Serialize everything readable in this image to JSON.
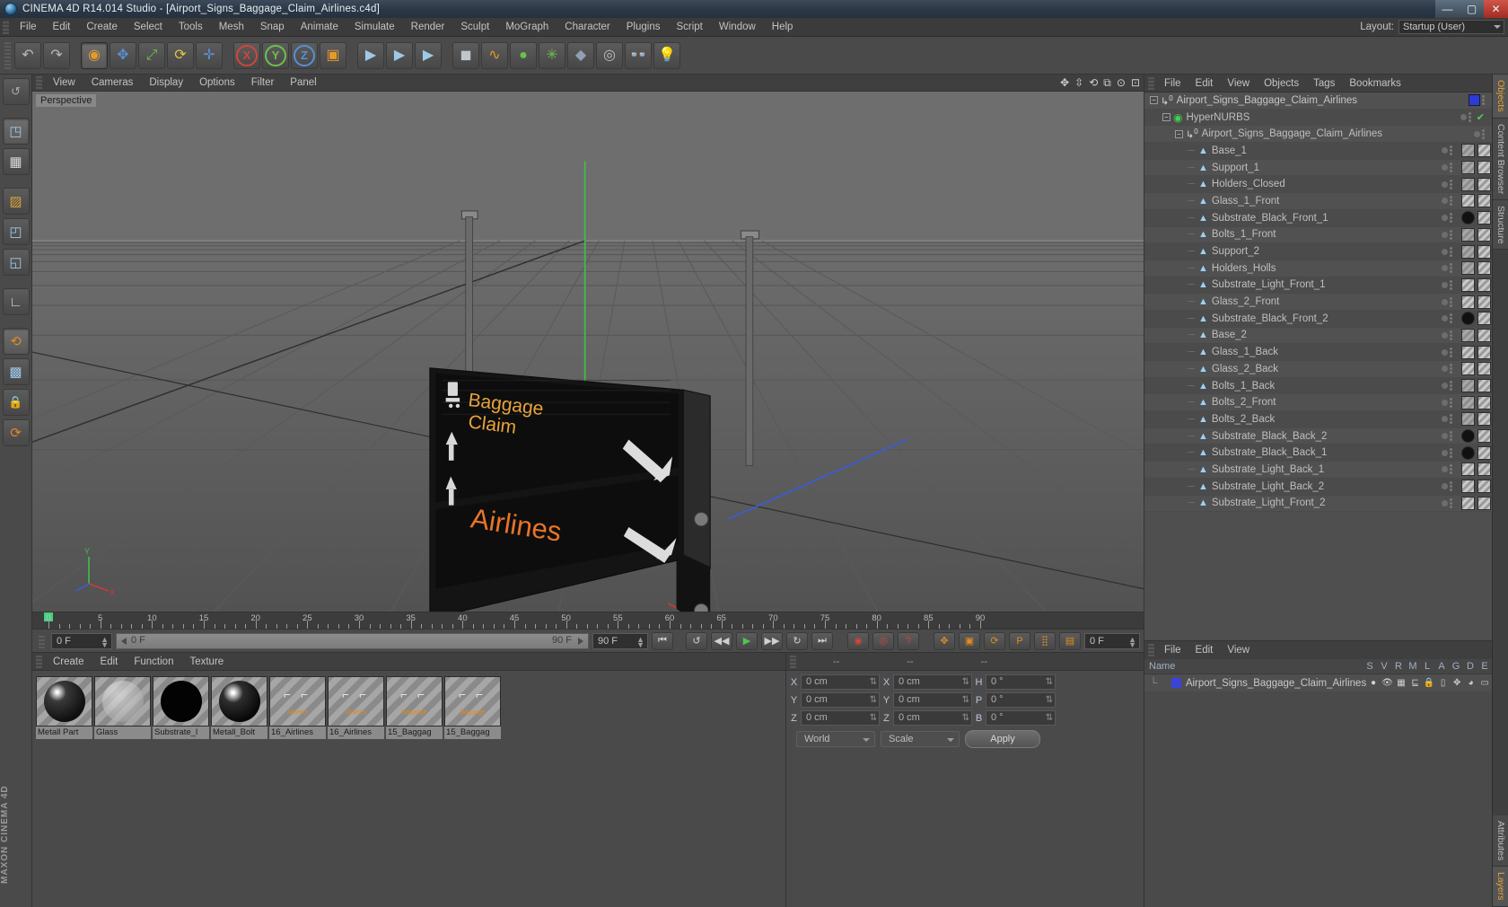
{
  "titlebar": {
    "title": "CINEMA 4D R14.014 Studio - [Airport_Signs_Baggage_Claim_Airlines.c4d]",
    "app_icon": "c4d-logo-icon",
    "minimize": "—",
    "maximize": "▢",
    "close": "✕"
  },
  "menubar": {
    "items": [
      "File",
      "Edit",
      "Create",
      "Select",
      "Tools",
      "Mesh",
      "Snap",
      "Animate",
      "Simulate",
      "Render",
      "Sculpt",
      "MoGraph",
      "Character",
      "Plugins",
      "Script",
      "Window",
      "Help"
    ],
    "layout_label": "Layout:",
    "layout_value": "Startup (User)"
  },
  "toolbar": {
    "buttons": [
      {
        "name": "undo-button",
        "glyph": "↶"
      },
      {
        "name": "redo-button",
        "glyph": "↷"
      },
      {
        "name": "live-selection-button",
        "glyph": "◉"
      },
      {
        "name": "move-button",
        "glyph": "✥"
      },
      {
        "name": "scale-button",
        "glyph": "⤢"
      },
      {
        "name": "rotate-button",
        "glyph": "⟳"
      },
      {
        "name": "mode-button",
        "glyph": "✛"
      },
      {
        "name": "lock-x-axis-button",
        "glyph": "X"
      },
      {
        "name": "lock-y-axis-button",
        "glyph": "Y"
      },
      {
        "name": "lock-z-axis-button",
        "glyph": "Z"
      },
      {
        "name": "world-object-coordinate-button",
        "glyph": "▣"
      },
      {
        "name": "render-view-button",
        "glyph": "▶"
      },
      {
        "name": "render-region-button",
        "glyph": "▶"
      },
      {
        "name": "render-settings-button",
        "glyph": "▶"
      },
      {
        "name": "add-cube-button",
        "glyph": "◼"
      },
      {
        "name": "add-spline-button",
        "glyph": "∿"
      },
      {
        "name": "add-nurbs-button",
        "glyph": "●"
      },
      {
        "name": "add-array-button",
        "glyph": "✳"
      },
      {
        "name": "add-scene-object-button",
        "glyph": "◆"
      },
      {
        "name": "add-camera-button",
        "glyph": "◎"
      },
      {
        "name": "add-stage-button",
        "glyph": "👓"
      },
      {
        "name": "add-light-button",
        "glyph": "💡"
      }
    ]
  },
  "lefttools": [
    {
      "name": "model-mode-button",
      "glyph": "◳"
    },
    {
      "name": "texture-mode-button",
      "glyph": "▦"
    },
    {
      "name": "points-mode-button",
      "glyph": "▨"
    },
    {
      "name": "edges-mode-button",
      "glyph": "◰"
    },
    {
      "name": "polygons-mode-button",
      "glyph": "◱"
    },
    {
      "name": "object-axis-mode-button",
      "glyph": "◲"
    },
    {
      "name": "workplane-button",
      "glyph": "∟"
    },
    {
      "name": "enable-axis-button",
      "glyph": "⟲"
    },
    {
      "name": "enable-snap-button",
      "glyph": "▩"
    },
    {
      "name": "lock-button",
      "glyph": "🔒"
    },
    {
      "name": "viewport-solo-button",
      "glyph": "⟳"
    }
  ],
  "maxon_logo": "MAXON CINEMA 4D",
  "viewport": {
    "menu": [
      "View",
      "Cameras",
      "Display",
      "Options",
      "Filter",
      "Panel"
    ],
    "label": "Perspective",
    "corner_icons": [
      "pan-icon",
      "zoom-icon",
      "rotate-icon",
      "maximize-icon",
      "config-icon",
      "close-icon"
    ],
    "sign_line1": "Baggage",
    "sign_line2": "Claim",
    "sign_line3": "Airlines",
    "axis_y_label": "Y",
    "axis_x_label": "X",
    "sign_text_color": "#e8a23a"
  },
  "timeline": {
    "ticks": [
      0,
      5,
      10,
      15,
      20,
      25,
      30,
      35,
      40,
      45,
      50,
      55,
      60,
      65,
      70,
      75,
      80,
      85,
      90
    ],
    "playhead_frame": 0,
    "current_frame_field": "0 F",
    "range_start": "0 F",
    "range_end": "90 F",
    "max_frame_field": "90 F",
    "end_frame_field": "0 F",
    "transport": [
      {
        "name": "goto-start-button",
        "glyph": "⏮"
      },
      {
        "name": "step-back-key-button",
        "glyph": "↺"
      },
      {
        "name": "step-back-frame-button",
        "glyph": "◀◀"
      },
      {
        "name": "play-button",
        "glyph": "▶"
      },
      {
        "name": "step-forward-frame-button",
        "glyph": "▶▶"
      },
      {
        "name": "step-forward-key-button",
        "glyph": "↻"
      },
      {
        "name": "goto-end-button",
        "glyph": "⏭"
      }
    ],
    "record_buttons": [
      {
        "name": "record-active-objects-button",
        "glyph": "◉"
      },
      {
        "name": "autokeying-button",
        "glyph": "◎"
      },
      {
        "name": "keyframe-selection-button",
        "glyph": "?"
      },
      {
        "name": "position-key-button",
        "glyph": "✥"
      },
      {
        "name": "scale-key-button",
        "glyph": "▣"
      },
      {
        "name": "rotation-key-button",
        "glyph": "⟳"
      },
      {
        "name": "parameter-key-button",
        "glyph": "P"
      },
      {
        "name": "point-level-animation-button",
        "glyph": "⣿"
      },
      {
        "name": "timeline-button",
        "glyph": "▤"
      }
    ]
  },
  "materials": {
    "menu": [
      "Create",
      "Edit",
      "Function",
      "Texture"
    ],
    "items": [
      {
        "name": "Metall Part",
        "type": "sphere",
        "color": "#1d1d1d"
      },
      {
        "name": "Glass",
        "type": "sphere",
        "color": "#c5c5c5"
      },
      {
        "name": "Substrate_l",
        "type": "sphere",
        "color": "#020202"
      },
      {
        "name": "Metall_Bolt",
        "type": "sphere",
        "color": "#151515"
      },
      {
        "name": "16_Airlines",
        "type": "texture",
        "color": "#d08a2a"
      },
      {
        "name": "16_Airlines",
        "type": "texture",
        "color": "#d08a2a"
      },
      {
        "name": "15_Baggag",
        "type": "texture",
        "color": "#d08a2a"
      },
      {
        "name": "15_Baggag",
        "type": "texture",
        "color": "#d08a2a"
      }
    ]
  },
  "coordinates": {
    "header_dashes": [
      "--",
      "--",
      "--"
    ],
    "rows": [
      {
        "pos_label": "X",
        "pos_value": "0 cm",
        "size_label": "X",
        "size_value": "0 cm",
        "rot_label": "H",
        "rot_value": "0 °"
      },
      {
        "pos_label": "Y",
        "pos_value": "0 cm",
        "size_label": "Y",
        "size_value": "0 cm",
        "rot_label": "P",
        "rot_value": "0 °"
      },
      {
        "pos_label": "Z",
        "pos_value": "0 cm",
        "size_label": "Z",
        "size_value": "0 cm",
        "rot_label": "B",
        "rot_value": "0 °"
      }
    ],
    "system_dropdown": "World",
    "mode_dropdown": "Scale",
    "apply_button": "Apply"
  },
  "objects": {
    "menu": [
      "File",
      "Edit",
      "View",
      "Objects",
      "Tags",
      "Bookmarks"
    ],
    "tree": [
      {
        "label": "Airport_Signs_Baggage_Claim_Airlines",
        "depth": 0,
        "icon": "null-object-icon",
        "expander": true,
        "color_chip": "#2b3bd8",
        "tags": []
      },
      {
        "label": "HyperNURBS",
        "depth": 1,
        "icon": "hypernurbs-icon",
        "expander": true,
        "check": true,
        "tags": []
      },
      {
        "label": "Airport_Signs_Baggage_Claim_Airlines",
        "depth": 2,
        "icon": "null-object-icon",
        "expander": true,
        "tags": [
          "dot",
          "dot"
        ]
      },
      {
        "label": "Base_1",
        "depth": 3,
        "icon": "polygon-object-icon",
        "tags": [
          "dot",
          "mat",
          "uv"
        ]
      },
      {
        "label": "Support_1",
        "depth": 3,
        "icon": "polygon-object-icon",
        "tags": [
          "dot",
          "mat",
          "uv"
        ]
      },
      {
        "label": "Holders_Closed",
        "depth": 3,
        "icon": "polygon-object-icon",
        "tags": [
          "dot",
          "mat",
          "uv"
        ]
      },
      {
        "label": "Glass_1_Front",
        "depth": 3,
        "icon": "polygon-object-icon",
        "tags": [
          "dot",
          "uv",
          "uv"
        ]
      },
      {
        "label": "Substrate_Black_Front_1",
        "depth": 3,
        "icon": "polygon-object-icon",
        "tags": [
          "dot",
          "blk",
          "uv"
        ]
      },
      {
        "label": "Bolts_1_Front",
        "depth": 3,
        "icon": "polygon-object-icon",
        "tags": [
          "dot",
          "mat",
          "uv"
        ]
      },
      {
        "label": "Support_2",
        "depth": 3,
        "icon": "polygon-object-icon",
        "tags": [
          "dot",
          "mat",
          "uv"
        ]
      },
      {
        "label": "Holders_Holls",
        "depth": 3,
        "icon": "polygon-object-icon",
        "tags": [
          "dot",
          "mat",
          "uv"
        ]
      },
      {
        "label": "Substrate_Light_Front_1",
        "depth": 3,
        "icon": "polygon-object-icon",
        "tags": [
          "dot",
          "uv",
          "uv"
        ]
      },
      {
        "label": "Glass_2_Front",
        "depth": 3,
        "icon": "polygon-object-icon",
        "tags": [
          "dot",
          "uv",
          "uv"
        ]
      },
      {
        "label": "Substrate_Black_Front_2",
        "depth": 3,
        "icon": "polygon-object-icon",
        "tags": [
          "dot",
          "blk",
          "uv"
        ]
      },
      {
        "label": "Base_2",
        "depth": 3,
        "icon": "polygon-object-icon",
        "tags": [
          "dot",
          "mat",
          "uv"
        ]
      },
      {
        "label": "Glass_1_Back",
        "depth": 3,
        "icon": "polygon-object-icon",
        "tags": [
          "dot",
          "uv",
          "uv"
        ]
      },
      {
        "label": "Glass_2_Back",
        "depth": 3,
        "icon": "polygon-object-icon",
        "tags": [
          "dot",
          "uv",
          "uv"
        ]
      },
      {
        "label": "Bolts_1_Back",
        "depth": 3,
        "icon": "polygon-object-icon",
        "tags": [
          "dot",
          "mat",
          "uv"
        ]
      },
      {
        "label": "Bolts_2_Front",
        "depth": 3,
        "icon": "polygon-object-icon",
        "tags": [
          "dot",
          "mat",
          "uv"
        ]
      },
      {
        "label": "Bolts_2_Back",
        "depth": 3,
        "icon": "polygon-object-icon",
        "tags": [
          "dot",
          "mat",
          "uv"
        ]
      },
      {
        "label": "Substrate_Black_Back_2",
        "depth": 3,
        "icon": "polygon-object-icon",
        "tags": [
          "dot",
          "blk",
          "uv"
        ]
      },
      {
        "label": "Substrate_Black_Back_1",
        "depth": 3,
        "icon": "polygon-object-icon",
        "tags": [
          "dot",
          "blk",
          "uv"
        ]
      },
      {
        "label": "Substrate_Light_Back_1",
        "depth": 3,
        "icon": "polygon-object-icon",
        "tags": [
          "dot",
          "uv",
          "uv"
        ]
      },
      {
        "label": "Substrate_Light_Back_2",
        "depth": 3,
        "icon": "polygon-object-icon",
        "tags": [
          "dot",
          "uv",
          "uv"
        ]
      },
      {
        "label": "Substrate_Light_Front_2",
        "depth": 3,
        "icon": "polygon-object-icon",
        "tags": [
          "dot",
          "uv",
          "uv"
        ]
      }
    ]
  },
  "layers": {
    "menu": [
      "File",
      "Edit",
      "View"
    ],
    "columns": [
      "Name",
      "S",
      "V",
      "R",
      "M",
      "L",
      "A",
      "G",
      "D",
      "E"
    ],
    "rows": [
      {
        "name": "Airport_Signs_Baggage_Claim_Airlines",
        "color": "#2b3bd8",
        "icons": [
          "solo-dot",
          "eye-icon",
          "render-icon",
          "manager-icon",
          "lock-icon",
          "animation-icon",
          "generator-icon",
          "deformer-icon",
          "expression-icon"
        ]
      }
    ]
  },
  "vtabs": {
    "top": [
      "Objects",
      "Content Browser",
      "Structure"
    ],
    "bottom": [
      "Attributes",
      "Layers"
    ],
    "active_top": "Objects",
    "active_bottom": "Layers"
  }
}
